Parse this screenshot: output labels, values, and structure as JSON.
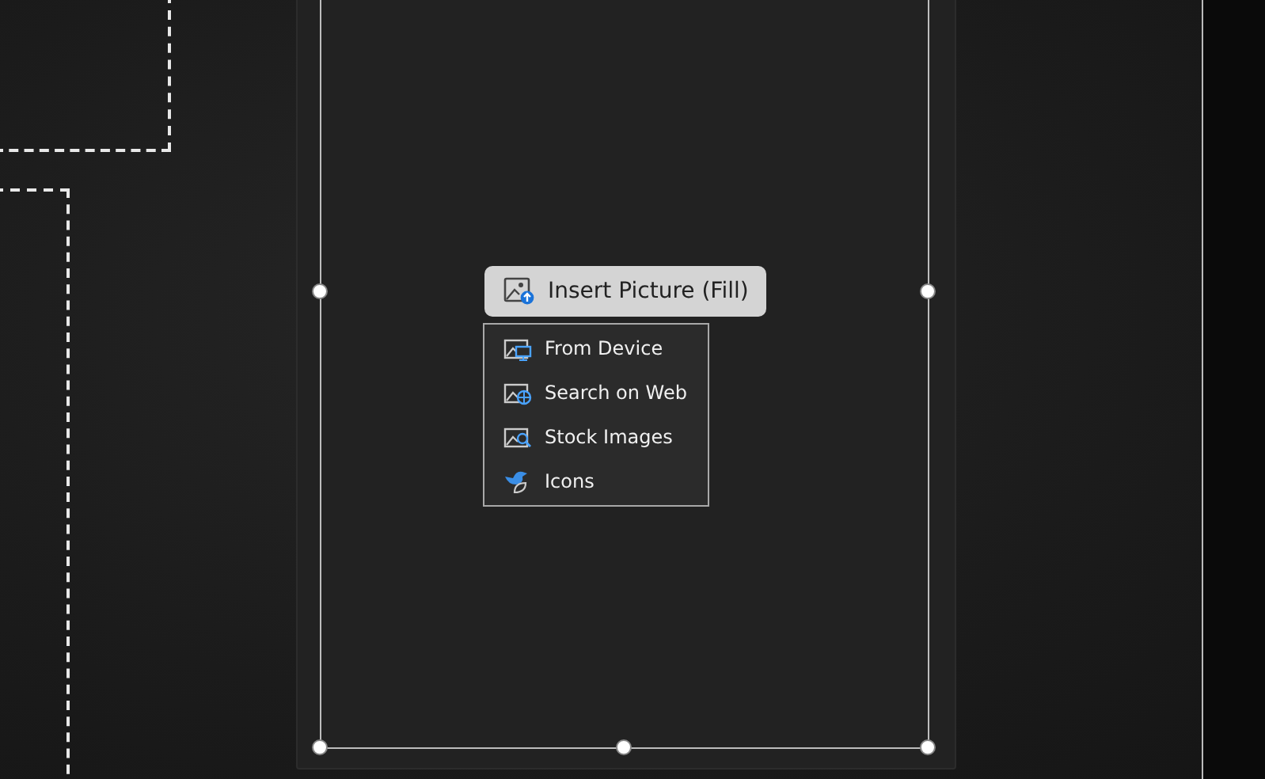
{
  "insert_button": {
    "label": "Insert Picture (Fill)"
  },
  "menu": {
    "items": [
      {
        "label": "From Device",
        "kind": "device"
      },
      {
        "label": "Search on Web",
        "kind": "web"
      },
      {
        "label": "Stock Images",
        "kind": "stock"
      },
      {
        "label": "Icons",
        "kind": "icons"
      }
    ]
  }
}
